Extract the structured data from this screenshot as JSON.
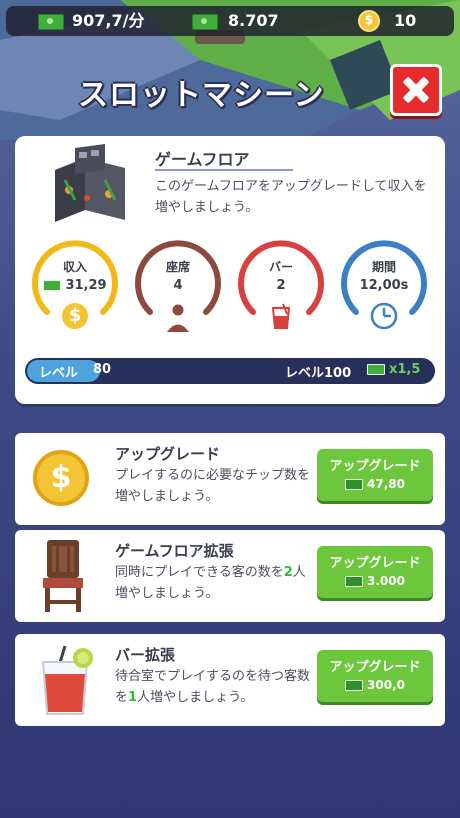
{
  "topbar": {
    "income_rate": "907,7/分",
    "cash": "8.707",
    "chips": "10"
  },
  "header": {
    "title": "スロットマシーン"
  },
  "floor": {
    "name": "ゲームフロア",
    "desc": "このゲームフロアをアップグレードして収入を増やしましょう。",
    "stats": [
      {
        "label": "収入",
        "value": "31,29",
        "color": "#f1b918",
        "icon": "coin-icon"
      },
      {
        "label": "座席",
        "value": "4",
        "color": "#8b4a3c",
        "icon": "person-icon"
      },
      {
        "label": "バー",
        "value": "2",
        "color": "#d8403f",
        "icon": "drink-icon"
      },
      {
        "label": "期間",
        "value": "12,00s",
        "color": "#3b7fc4",
        "icon": "clock-icon"
      }
    ],
    "level": {
      "current_label": "レベル",
      "current": "80",
      "max": "レベル100",
      "multiplier": "x1,5",
      "progress": 0.18
    }
  },
  "upgrades": [
    {
      "title": "アップグレード",
      "desc1": "プレイするのに必要なチップ数を増やしましょう。",
      "button": "アップグレード",
      "price": "47,80"
    },
    {
      "title": "ゲームフロア拡張",
      "desc_pre": "同時にプレイできる客の数を",
      "desc_num": "2",
      "desc_post": "人増やしましょう。",
      "button": "アップグレード",
      "price": "3.000"
    },
    {
      "title": "バー拡張",
      "desc_pre": "待合室でプレイするのを待つ客数を",
      "desc_num": "1",
      "desc_post": "人増やしましょう。",
      "button": "アップグレード",
      "price": "300,0"
    }
  ]
}
